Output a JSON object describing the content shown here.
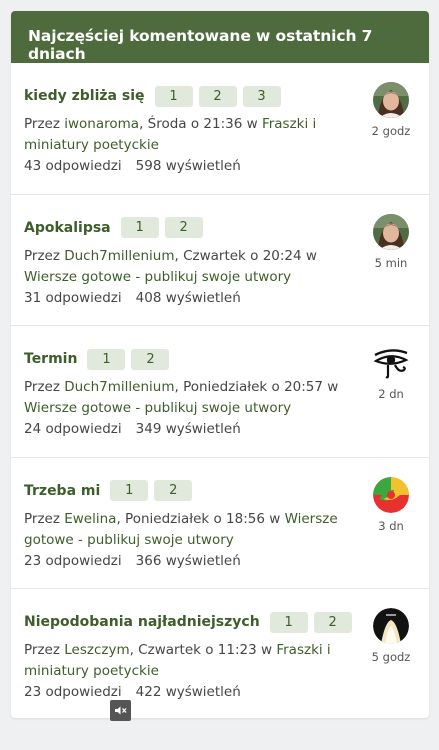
{
  "header": {
    "title": "Najczęściej komentowane w ostatnich 7 dniach"
  },
  "topics": [
    {
      "title": "kiedy zbliża się",
      "pages": [
        "1",
        "2",
        "3"
      ],
      "by": "Przez ",
      "author": "iwonaroma",
      "when": ", Środa o 21:36 w ",
      "forum": "Fraszki i miniatury poetyckie",
      "replies": "43 odpowiedzi",
      "views": "598 wyświetleń",
      "ago": "2 godz",
      "avatar_icon": "woman-photo-avatar"
    },
    {
      "title": "Apokalipsa",
      "pages": [
        "1",
        "2"
      ],
      "by": "Przez ",
      "author": "Duch7millenium",
      "when": ", Czwartek o 20:24 w ",
      "forum": "Wiersze gotowe - publikuj swoje utwory",
      "replies": "31 odpowiedzi",
      "views": "408 wyświetleń",
      "ago": "5 min",
      "avatar_icon": "woman-photo-avatar"
    },
    {
      "title": "Termin",
      "pages": [
        "1",
        "2"
      ],
      "by": "Przez ",
      "author": "Duch7millenium",
      "when": ", Poniedziałek o 20:57 w ",
      "forum": "Wiersze gotowe - publikuj swoje utwory",
      "replies": "24 odpowiedzi",
      "views": "349 wyświetleń",
      "ago": "2 dn",
      "avatar_icon": "eye-of-horus-avatar"
    },
    {
      "title": "Trzeba mi",
      "pages": [
        "1",
        "2"
      ],
      "by": "Przez ",
      "author": "Ewelina",
      "when": ", Poniedziałek o 18:56 w ",
      "forum": "Wiersze gotowe - publikuj swoje utwory",
      "replies": "23 odpowiedzi",
      "views": "366 wyświetleń",
      "ago": "3 dn",
      "avatar_icon": "colorful-swirl-avatar"
    },
    {
      "title": "Niepodobania najładniejszych",
      "pages": [
        "1",
        "2"
      ],
      "by": "Przez ",
      "author": "Leszczym",
      "when": ", Czwartek o 11:23 w ",
      "forum": "Fraszki i miniatury poetyckie",
      "replies": "23 odpowiedzi",
      "views": "422 wyświetleń",
      "ago": "5 godz",
      "avatar_icon": "dark-light-avatar"
    }
  ],
  "colors": {
    "header_bg": "#4e6b3d",
    "link": "#3d5e2a",
    "page_btn_bg": "#e1e9dc"
  },
  "mute_icon": "speaker-mute-icon"
}
